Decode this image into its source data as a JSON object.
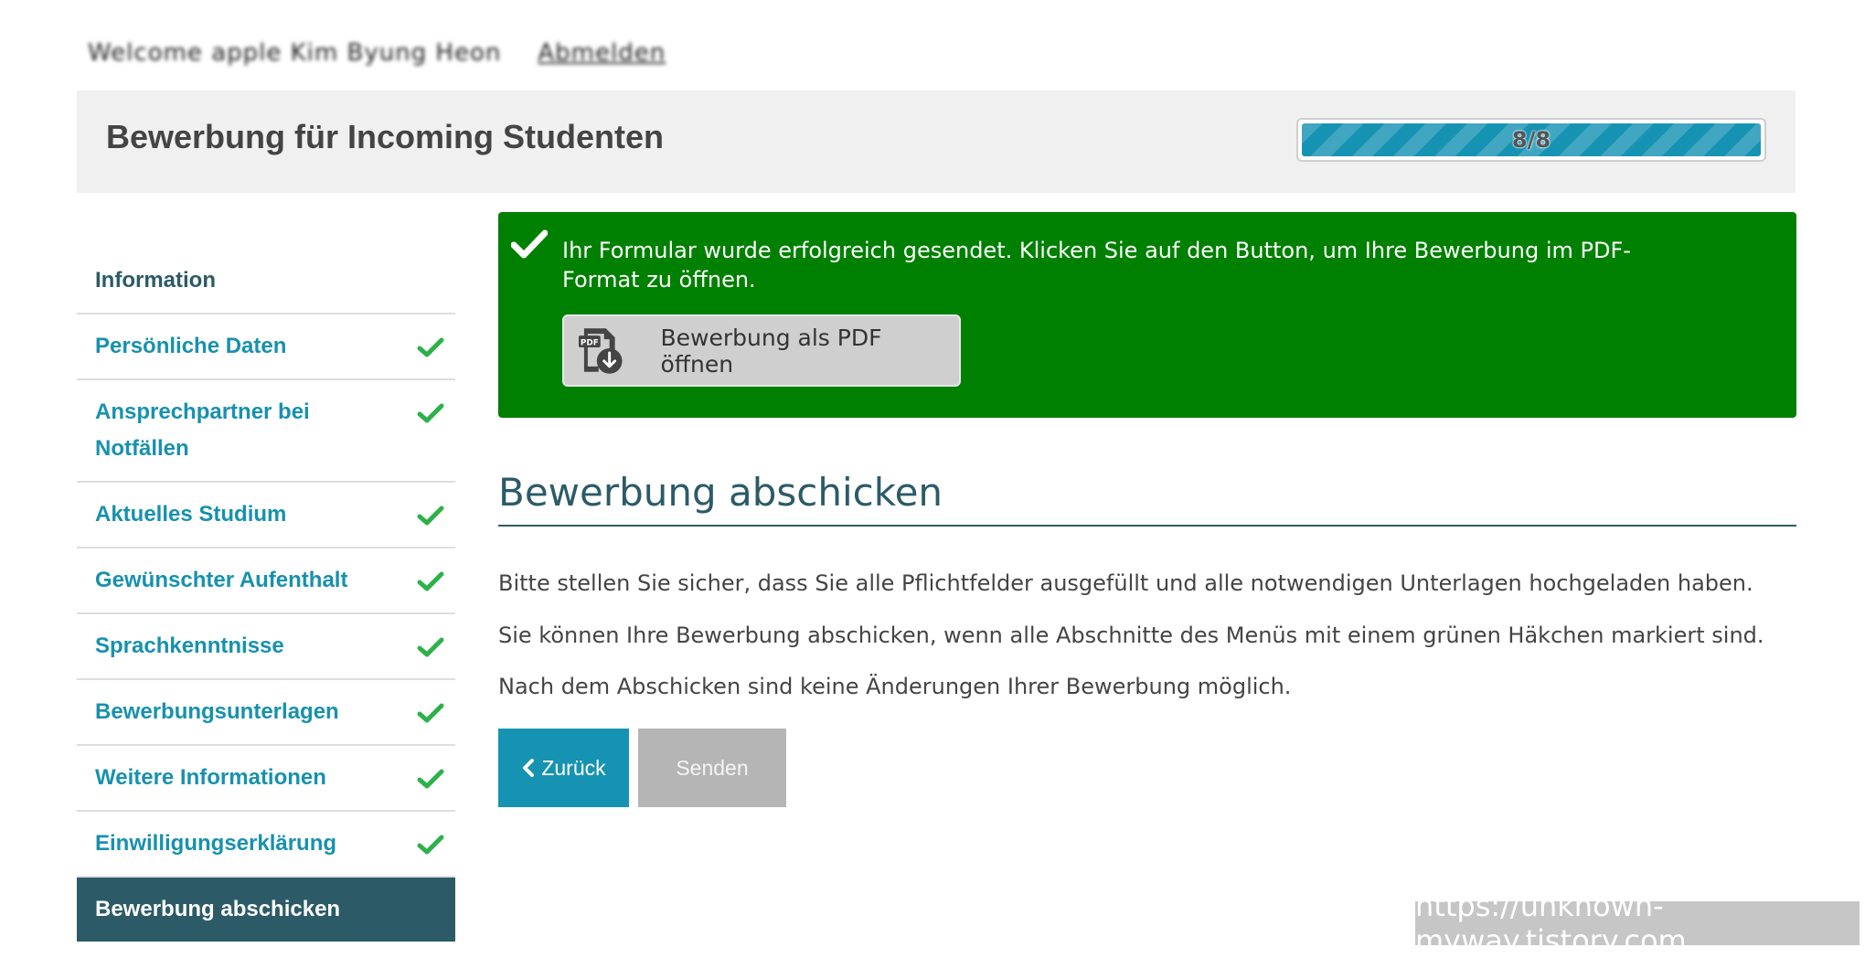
{
  "user_bar": {
    "name": "Welcome apple Kim Byung Heon",
    "logout": "Abmelden"
  },
  "header": {
    "title": "Bewerbung für Incoming Studenten",
    "progress_text": "8/8",
    "progress_fraction": 1.0
  },
  "sidebar": {
    "items": [
      {
        "label": "Information",
        "completed": false,
        "active": false
      },
      {
        "label": "Persönliche Daten",
        "completed": true,
        "active": false
      },
      {
        "label": "Ansprechpartner bei Notfällen",
        "completed": true,
        "active": false
      },
      {
        "label": "Aktuelles Studium",
        "completed": true,
        "active": false
      },
      {
        "label": "Gewünschter Aufenthalt",
        "completed": true,
        "active": false
      },
      {
        "label": "Sprachkenntnisse",
        "completed": true,
        "active": false
      },
      {
        "label": "Bewerbungsunterlagen",
        "completed": true,
        "active": false
      },
      {
        "label": "Weitere Informationen",
        "completed": true,
        "active": false
      },
      {
        "label": "Einwilligungserklärung",
        "completed": true,
        "active": false
      },
      {
        "label": "Bewerbung abschicken",
        "completed": false,
        "active": true
      }
    ]
  },
  "alert": {
    "message": "Ihr Formular wurde erfolgreich gesendet. Klicken Sie auf den Button, um Ihre Bewerbung im PDF-Format zu öffnen.",
    "pdf_button_label": "Bewerbung als PDF öffnen",
    "pdf_icon_text": "PDF"
  },
  "main": {
    "section_title": "Bewerbung abschicken",
    "paragraphs": [
      "Bitte stellen Sie sicher, dass Sie alle Pflichtfelder ausgefüllt und alle notwendigen Unterlagen hochgeladen haben.",
      "Sie können Ihre Bewerbung abschicken, wenn alle Abschnitte des Menüs mit einem grünen Häkchen markiert sind.",
      "Nach dem Abschicken sind keine Änderungen Ihrer Bewerbung möglich."
    ],
    "back_label": "Zurück",
    "send_label": "Senden"
  },
  "watermark": "https://unknown-myway.tistory.com",
  "colors": {
    "primary": "#1693b3",
    "dark": "#2c5b67",
    "success_bg": "#008000",
    "check": "#2db14a"
  }
}
